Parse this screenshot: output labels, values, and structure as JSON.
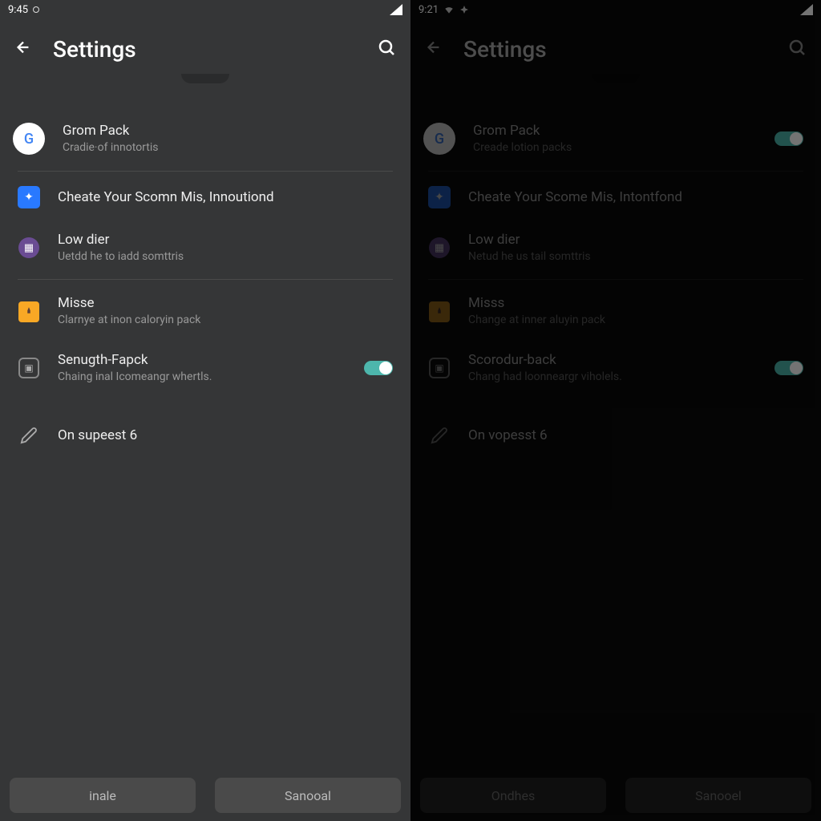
{
  "left": {
    "status_time": "9:45",
    "header": {
      "title": "Settings"
    },
    "items": [
      {
        "title": "Grom Pack",
        "sub": "Cradie·of innotortis"
      },
      {
        "title": "Cheate Your Scomn Mis, Innoutiond",
        "sub": ""
      },
      {
        "title": "Low dier",
        "sub": "Uetdd he to iadd somttris"
      },
      {
        "title": "Misse",
        "sub": "Clarnye at inon caloryin pack"
      },
      {
        "title": "Senugth-Fapck",
        "sub": "Chaing inal Icomeangr whertls."
      },
      {
        "title": "On supeest 6",
        "sub": ""
      }
    ],
    "buttons": {
      "left": "inale",
      "right": "Sanooal"
    }
  },
  "right": {
    "status_time": "9:21",
    "header": {
      "title": "Settings"
    },
    "items": [
      {
        "title": "Grom Pack",
        "sub": "Creade lotion packs"
      },
      {
        "title": "Cheate Your Scome Mis, Intontfond",
        "sub": ""
      },
      {
        "title": "Low dier",
        "sub": "Netud he us tail somttris"
      },
      {
        "title": "Misss",
        "sub": "Change at inner aluyin pack"
      },
      {
        "title": "Scorodur-back",
        "sub": "Chang had loonneargr viholels."
      },
      {
        "title": "On vopesst 6",
        "sub": ""
      }
    ],
    "buttons": {
      "left": "Ondhes",
      "right": "Sanooel"
    }
  }
}
